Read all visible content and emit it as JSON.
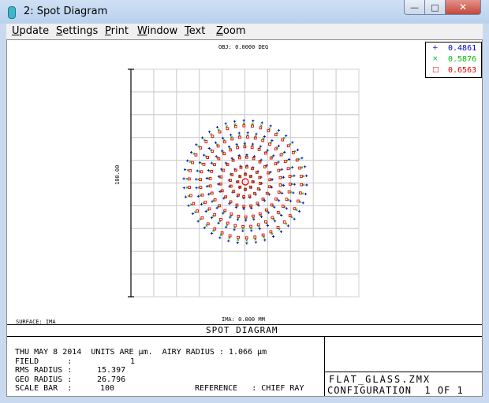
{
  "window": {
    "title": "2: Spot Diagram",
    "minimize_icon": "minimize-icon",
    "maximize_icon": "maximize-icon",
    "close_icon": "close-icon",
    "min_glyph": "—",
    "max_glyph": "□",
    "close_glyph": "✕"
  },
  "menu": {
    "items": [
      "Update",
      "Settings",
      "Print",
      "Window",
      "Text",
      "Zoom"
    ]
  },
  "plot": {
    "obj_label": "OBJ: 0.0000 DEG",
    "scale_label": "100.00",
    "surface_label": "SURFACE: IMA",
    "ima_label": "IMA: 0.000 MM"
  },
  "legend": [
    {
      "label": "0.4861",
      "color": "#0000cc",
      "marker": "+"
    },
    {
      "label": "0.5876",
      "color": "#00c000",
      "marker": "×"
    },
    {
      "label": "0.6563",
      "color": "#e00000",
      "marker": "□"
    }
  ],
  "footer": {
    "banner": "SPOT DIAGRAM",
    "line1": "THU MAY 8 2014  UNITS ARE µm.  AIRY RADIUS : 1.066 µm",
    "field_label": "FIELD      :",
    "field_value": "1",
    "rms_label": "RMS RADIUS :",
    "rms_value": "15.397",
    "geo_label": "GEO RADIUS :",
    "geo_value": "26.796",
    "scale_label": "SCALE BAR  :",
    "scale_value": "100",
    "reference": "REFERENCE   : CHIEF RAY",
    "file": "FLAT_GLASS.ZMX",
    "config": "CONFIGURATION  1 OF 1"
  }
}
